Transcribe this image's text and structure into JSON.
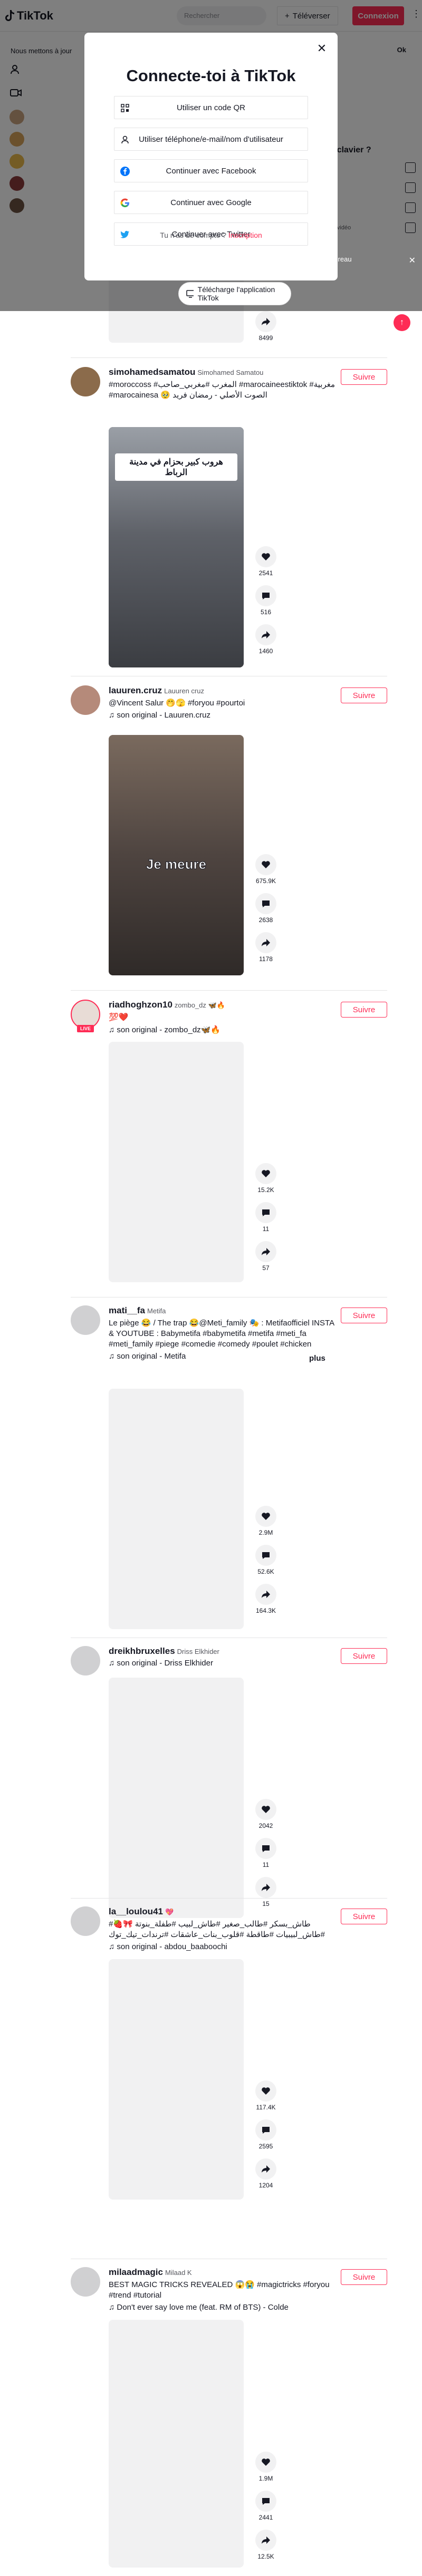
{
  "header": {
    "logo_text": "TikTok",
    "search_placeholder": "Rechercher",
    "upload_label": "Téléverser",
    "login_label": "Connexion"
  },
  "notice": {
    "text": "Nous mettons à jour",
    "ok_label": "Ok"
  },
  "modal": {
    "title": "Connecte-toi à TikTok",
    "options": [
      {
        "label": "Utiliser un code QR",
        "icon": "qr-code-icon"
      },
      {
        "label": "Utiliser téléphone/e-mail/nom d'utilisateur",
        "icon": "person-icon"
      },
      {
        "label": "Continuer avec Facebook",
        "icon": "facebook-icon"
      },
      {
        "label": "Continuer avec Google",
        "icon": "google-icon"
      },
      {
        "label": "Continuer avec Twitter",
        "icon": "twitter-icon"
      }
    ],
    "footer_text": "Tu n'as de compte ?",
    "footer_link": "Inscription"
  },
  "right_panel": {
    "title": "cis clavier ?",
    "row_text": "de la vidéo",
    "desktop_text": "de bureau",
    "download_label": "Télécharge l'application TikTok"
  },
  "posts": [
    {
      "username": "",
      "nickname": "",
      "caption": "",
      "music": "",
      "likes": "",
      "comments": "",
      "shares": "8499",
      "follow_label": "Suivre"
    },
    {
      "username": "simohamedsamatou",
      "nickname": "Simohamed Samatou",
      "caption": "#moroccoss #المغرب #مغربي_صاحب #marocaineestiktok #مغربية #marocainesa 🥹 الصوت الأصلي - رمضان فريد",
      "music": "",
      "video_text": "هروب كبير بحزام في مدينة الرباط",
      "likes": "2541",
      "comments": "516",
      "shares": "1460",
      "follow_label": "Suivre"
    },
    {
      "username": "lauuren.cruz",
      "nickname": "Lauuren cruz",
      "caption": "@Vincent Salur 🤭🫣 #foryou #pourtoi",
      "music": "son original - Lauuren.cruz",
      "video_text": "Je meure",
      "likes": "675.9K",
      "comments": "2638",
      "shares": "1178",
      "follow_label": "Suivre"
    },
    {
      "username": "riadhoghzon10",
      "nickname": "zombo_dz 🦋🔥",
      "caption": "💯❤️",
      "music": "son original - zombo_dz🦋🔥",
      "live_label": "LIVE",
      "likes": "15.2K",
      "comments": "11",
      "shares": "57",
      "follow_label": "Suivre"
    },
    {
      "username": "mati__fa",
      "nickname": "Metifa",
      "caption": "Le piège 😂 / The trap 😂@Meti_family 🎭 : Metifaofficiel INSTA & YOUTUBE : Babymetifa #babymetifa #metifa #meti_fa #meti_family #piege #comedie #comedy #poulet #chicken",
      "caption_more": "plus",
      "music": "son original - Metifa",
      "likes": "2.9M",
      "comments": "52.6K",
      "shares": "164.3K",
      "follow_label": "Suivre"
    },
    {
      "username": "dreikhbruxelles",
      "nickname": "Driss Elkhider",
      "caption": "",
      "music": "son original - Driss Elkhider",
      "likes": "2042",
      "comments": "11",
      "shares": "15",
      "follow_label": "Suivre"
    },
    {
      "username": "la__loulou41",
      "nickname": "💖",
      "caption": "#طاش_بسكر #طالب_صغير #طاش_لبيب #طفلة_بنوتة 🎀🍓 #طاش_لبيبيات #طاقطة #قلوب_بنات_عاشقات #ترندات_تيك_توك",
      "music": "son original - abdou_baaboochi",
      "likes": "117.4K",
      "comments": "2595",
      "shares": "1204",
      "follow_label": "Suivre"
    },
    {
      "username": "milaadmagic",
      "nickname": "Milaad K",
      "caption": "BEST MAGIC TRICKS REVEALED 😱😭 #magictricks #foryou #trend #tutorial",
      "music": "Don't ever say love me (feat. RM of BTS) - Colde",
      "likes": "1.9M",
      "comments": "2441",
      "shares": "12.5K",
      "follow_label": "Suivre"
    }
  ]
}
